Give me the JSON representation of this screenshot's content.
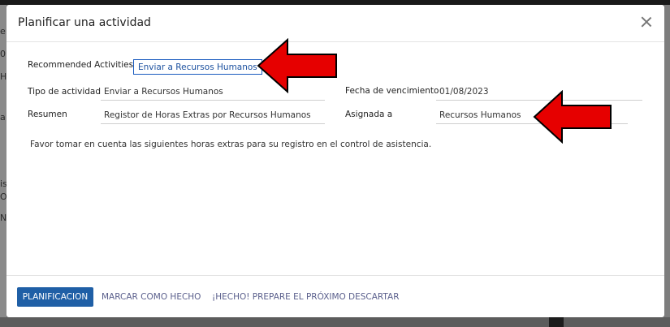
{
  "background": {
    "left_chars": [
      "e",
      "0",
      "H",
      "a",
      "is",
      "OI",
      "NT"
    ]
  },
  "dialog": {
    "title": "Planificar una actividad",
    "recommended_label": "Recommended Activities",
    "recommended_button": "Enviar a Recursos Humanos",
    "fields": {
      "activity_type_label": "Tipo de actividad",
      "activity_type_value": "Enviar a Recursos Humanos",
      "summary_label": "Resumen",
      "summary_value": "Registor de Horas Extras por Recursos Humanos",
      "due_date_label": "Fecha de vencimiento",
      "due_date_value": "01/08/2023",
      "assigned_label": "Asignada a",
      "assigned_value": "Recursos Humanos"
    },
    "note": "Favor tomar en cuenta las siguientes horas extras para su registro en el control de asistencia.",
    "footer": {
      "schedule": "PLANIFICACION",
      "mark_done": "MARCAR COMO HECHO",
      "done_next": "¡HECHO! PREPARE EL PRÓXIMO",
      "discard": "DESCARTAR"
    }
  },
  "colors": {
    "primary": "#1f5fa6",
    "annotation_arrow": "#e60000"
  },
  "icons": {
    "close": "close-icon"
  }
}
